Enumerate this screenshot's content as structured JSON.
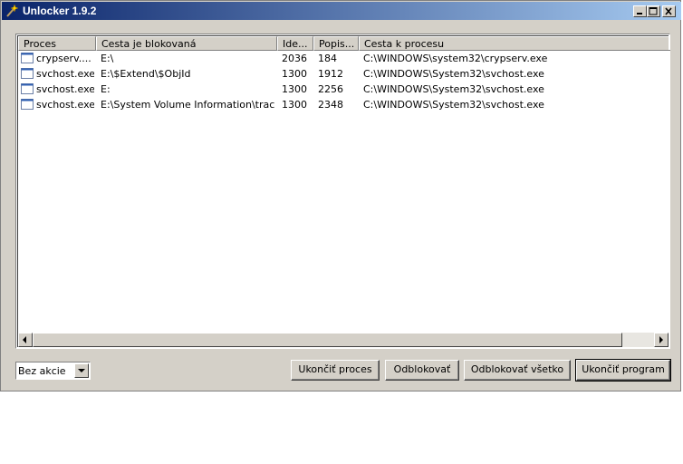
{
  "window": {
    "title": "Unlocker 1.9.2"
  },
  "columns": [
    "Proces",
    "Cesta je blokovaná",
    "Ide...",
    "Popis...",
    "Cesta k procesu"
  ],
  "rows": [
    {
      "process": "crypserv....",
      "path": "E:\\",
      "id": "2036",
      "handle": "184",
      "exe": "C:\\WINDOWS\\system32\\crypserv.exe"
    },
    {
      "process": "svchost.exe",
      "path": "E:\\$Extend\\$ObjId",
      "id": "1300",
      "handle": "1912",
      "exe": "C:\\WINDOWS\\System32\\svchost.exe"
    },
    {
      "process": "svchost.exe",
      "path": "E:",
      "id": "1300",
      "handle": "2256",
      "exe": "C:\\WINDOWS\\System32\\svchost.exe"
    },
    {
      "process": "svchost.exe",
      "path": "E:\\System Volume Information\\tracki...",
      "id": "1300",
      "handle": "2348",
      "exe": "C:\\WINDOWS\\System32\\svchost.exe"
    }
  ],
  "action_select": {
    "value": "Bez akcie"
  },
  "buttons": {
    "kill_process": "Ukončiť proces",
    "unlock": "Odblokovať",
    "unlock_all": "Odblokovať všetko",
    "quit": "Ukončiť program"
  },
  "colors": {
    "title_start": "#0a246a",
    "title_end": "#a6caf0",
    "face": "#d4d0c8"
  }
}
